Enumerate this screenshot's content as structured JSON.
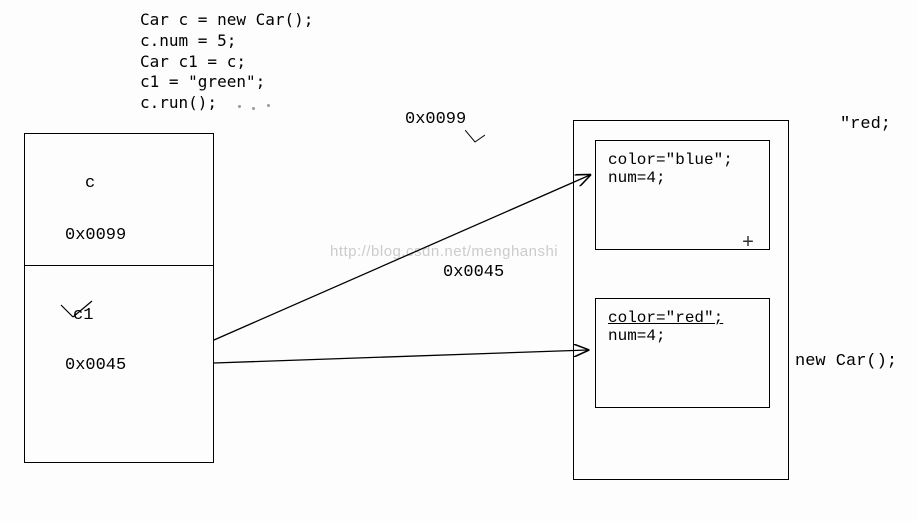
{
  "code": {
    "line1": "Car c = new Car();",
    "line2": "c.num = 5;",
    "line3": "Car c1 = c;",
    "line4": "c1 = \"green\";",
    "line5": "c.run();"
  },
  "stack": {
    "var1": {
      "name": "c",
      "address": "0x0099"
    },
    "var2": {
      "name": "c1",
      "address": "0x0045"
    }
  },
  "heap": {
    "addr_label1": "0x0099",
    "addr_label2": "0x0045",
    "obj1": {
      "color_line": "color=\"blue\";",
      "num_line": "num=4;"
    },
    "obj2": {
      "color_line": "color=\"red\";",
      "num_line": "num=4;"
    }
  },
  "side": {
    "red_fragment": "\"red;",
    "new_car": "new Car();"
  },
  "watermark": "http://blog.csdn.net/menghanshi"
}
